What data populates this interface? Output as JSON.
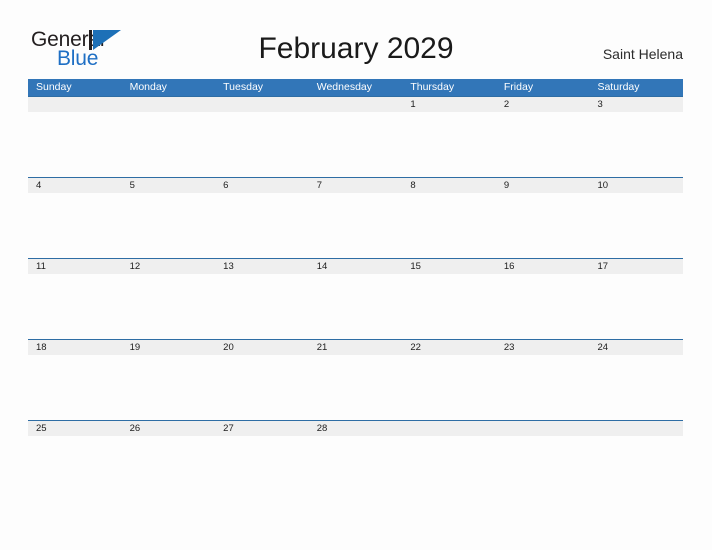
{
  "brand": {
    "name_part1": "General",
    "name_part2": "Blue",
    "mark_icon": "triangle-flag-icon",
    "accent_color": "#1d70b7"
  },
  "header": {
    "title": "February 2029",
    "location": "Saint Helena"
  },
  "calendar": {
    "month": "February",
    "year": "2029",
    "header_bg_color": "#3276b8",
    "row_divider_color": "#2e6da4",
    "daynum_strip_color": "#efefef",
    "weekdays": [
      "Sunday",
      "Monday",
      "Tuesday",
      "Wednesday",
      "Thursday",
      "Friday",
      "Saturday"
    ],
    "weeks": [
      {
        "days": [
          "",
          "",
          "",
          "",
          "1",
          "2",
          "3"
        ]
      },
      {
        "days": [
          "4",
          "5",
          "6",
          "7",
          "8",
          "9",
          "10"
        ]
      },
      {
        "days": [
          "11",
          "12",
          "13",
          "14",
          "15",
          "16",
          "17"
        ]
      },
      {
        "days": [
          "18",
          "19",
          "20",
          "21",
          "22",
          "23",
          "24"
        ]
      },
      {
        "days": [
          "25",
          "26",
          "27",
          "28",
          "",
          "",
          ""
        ]
      }
    ]
  }
}
